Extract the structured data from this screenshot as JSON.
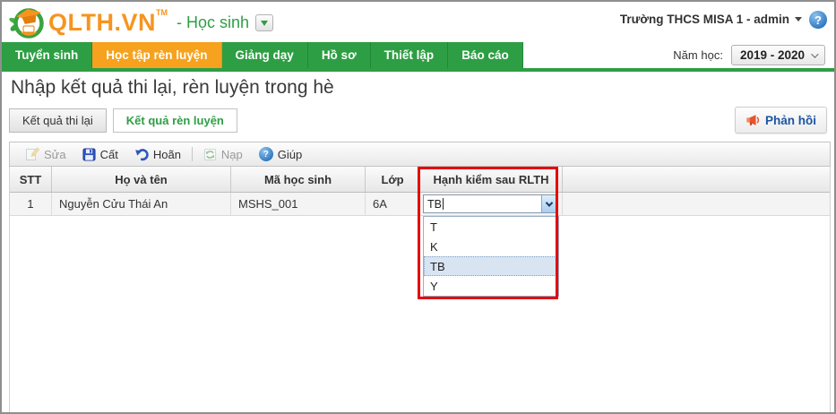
{
  "header": {
    "logo_text": "QLTH.VN",
    "logo_tm": "TM",
    "module_label": "- Học sinh",
    "account_label": "Trường THCS MISA 1 - admin",
    "help_glyph": "?"
  },
  "nav": {
    "tabs": [
      {
        "label": "Tuyển sinh"
      },
      {
        "label": "Học tập rèn luyện"
      },
      {
        "label": "Giảng dạy"
      },
      {
        "label": "Hồ sơ"
      },
      {
        "label": "Thiết lập"
      },
      {
        "label": "Báo cáo"
      }
    ],
    "active_tab": "Học tập rèn luyện",
    "school_year_label": "Năm học:",
    "school_year_value": "2019 - 2020"
  },
  "page": {
    "title": "Nhập kết quả thi lại, rèn luyện trong hè",
    "tab_thi_lai": "Kết quả thi lại",
    "tab_ren_luyen": "Kết quả rèn luyện",
    "feedback_label": "Phản hồi"
  },
  "toolbar": {
    "edit_label": "Sửa",
    "save_label": "Cất",
    "undo_label": "Hoãn",
    "refresh_label": "Nạp",
    "help_label": "Giúp",
    "help_glyph": "?"
  },
  "table": {
    "columns": {
      "stt": "STT",
      "name": "Họ và tên",
      "code": "Mã học sinh",
      "class": "Lớp",
      "conduct": "Hạnh kiểm sau RLTH"
    },
    "rows": [
      {
        "stt": "1",
        "name": "Nguyễn Cửu Thái An",
        "code": "MSHS_001",
        "class": "6A",
        "conduct_value": "TB"
      }
    ]
  },
  "conduct_dropdown": {
    "value": "TB",
    "options": [
      {
        "label": "T"
      },
      {
        "label": "K"
      },
      {
        "label": "TB"
      },
      {
        "label": "Y"
      }
    ],
    "selected_option": "TB"
  },
  "colors": {
    "brand_green": "#2E9E44",
    "active_orange": "#F6A21E",
    "logo_orange": "#F7941E",
    "feedback_blue": "#1C54A3",
    "highlight_red": "#E60000",
    "selection_blue": "#D9E4F2"
  }
}
